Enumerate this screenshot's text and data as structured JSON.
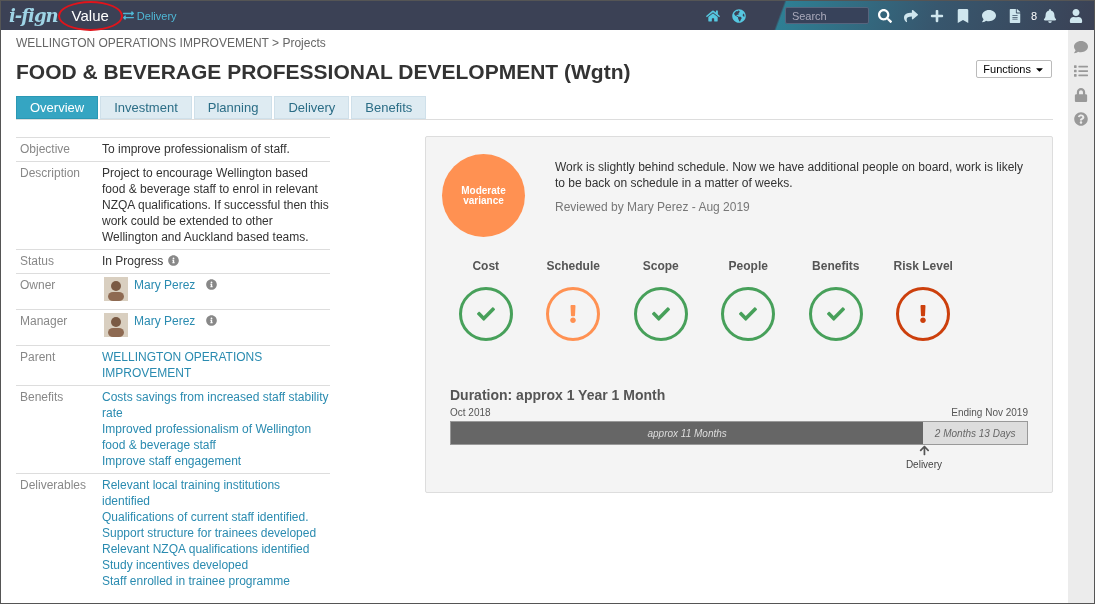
{
  "topbar": {
    "logo": "i-fign",
    "app_name": "Value",
    "module_link": "Delivery",
    "search": {
      "placeholder": "Search"
    },
    "notification_count": "8"
  },
  "breadcrumb": "WELLINGTON OPERATIONS IMPROVEMENT > Projects",
  "title": "FOOD & BEVERAGE PROFESSIONAL DEVELOPMENT (Wgtn)",
  "functions_button": "Functions",
  "tabs": [
    {
      "label": "Overview",
      "selected": true
    },
    {
      "label": "Investment",
      "selected": false
    },
    {
      "label": "Planning",
      "selected": false
    },
    {
      "label": "Delivery",
      "selected": false
    },
    {
      "label": "Benefits",
      "selected": false
    }
  ],
  "details": [
    {
      "label": "Objective",
      "kind": "text",
      "value": "To improve professionalism of staff."
    },
    {
      "label": "Description",
      "kind": "text",
      "value": "Project to encourage Wellington based food & beverage staff to enrol in relevant NZQA qualifications. If successful then this work could be extended to other Wellington and Auckland based teams."
    },
    {
      "label": "Status",
      "kind": "info",
      "value": "In Progress"
    },
    {
      "label": "Owner",
      "kind": "person",
      "value": "Mary Perez"
    },
    {
      "label": "Manager",
      "kind": "person",
      "value": "Mary Perez"
    },
    {
      "label": "Parent",
      "kind": "links",
      "links": [
        "WELLINGTON OPERATIONS IMPROVEMENT"
      ]
    },
    {
      "label": "Benefits",
      "kind": "links",
      "links": [
        "Costs savings from increased staff stability rate",
        "Improved professionalism of Wellington food & beverage staff",
        "Improve staff engagement"
      ]
    },
    {
      "label": "Deliverables",
      "kind": "links",
      "links": [
        "Relevant local training institutions identified",
        "Qualifications of current staff identified.",
        "Support structure for trainees developed",
        "Relevant NZQA qualifications identified",
        "Study incentives developed",
        "Staff enrolled in trainee programme"
      ]
    }
  ],
  "status_card": {
    "rating": "Moderate variance",
    "comment": "Work is slightly behind schedule. Now we have additional people on board, work is likely to be back on schedule in a matter of weeks.",
    "reviewed": "Reviewed by Mary Perez - Aug 2019",
    "indicators": [
      {
        "label": "Cost",
        "kind": "check",
        "color": "#47a05a"
      },
      {
        "label": "Schedule",
        "kind": "alert",
        "color": "#ff9152"
      },
      {
        "label": "Scope",
        "kind": "check",
        "color": "#47a05a"
      },
      {
        "label": "People",
        "kind": "check",
        "color": "#47a05a"
      },
      {
        "label": "Benefits",
        "kind": "check",
        "color": "#47a05a"
      },
      {
        "label": "Risk Level",
        "kind": "alert",
        "color": "#cc3f0c"
      }
    ],
    "duration": {
      "title": "Duration: approx 1 Year 1 Month",
      "start": "Oct 2018",
      "end": "Ending Nov 2019",
      "elapsed": "approx 11 Months",
      "remaining": "2 Months 13 Days",
      "level": 0.82,
      "marker": "Delivery"
    }
  }
}
